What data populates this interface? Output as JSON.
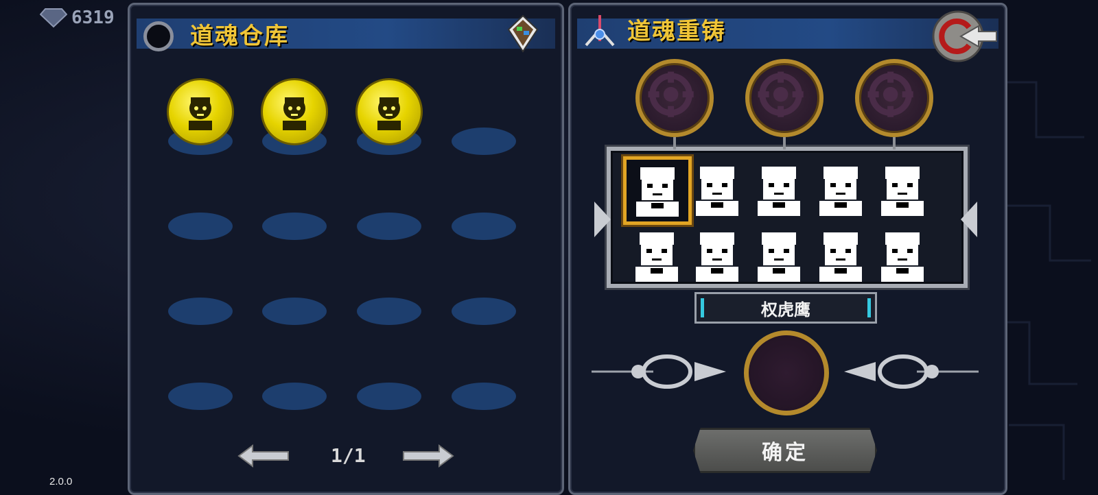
{
  "hud": {
    "gem_count": "6319",
    "version": "2.0.0"
  },
  "left_panel": {
    "title": "道魂仓库",
    "slots_rows": 4,
    "slots_cols": 4,
    "souls": [
      {
        "icon": "gold-soul-girl-icon"
      },
      {
        "icon": "gold-soul-mask-icon"
      },
      {
        "icon": "gold-soul-bun-icon"
      }
    ],
    "pager": {
      "label": "1/1"
    }
  },
  "right_panel": {
    "title": "道魂重铸",
    "selected_name": "权虎鹰",
    "confirm_label": "确定",
    "portraits": [
      {
        "icon": "portrait-bangs-icon"
      },
      {
        "icon": "portrait-glasses-icon"
      },
      {
        "icon": "portrait-bandana-icon"
      },
      {
        "icon": "portrait-longhair-icon"
      },
      {
        "icon": "portrait-masked-icon"
      },
      {
        "icon": "portrait-tusk-icon"
      },
      {
        "icon": "portrait-flower-icon"
      },
      {
        "icon": "portrait-cowboy-icon"
      },
      {
        "icon": "portrait-viking-icon"
      },
      {
        "icon": "portrait-bunny-icon"
      }
    ]
  },
  "colors": {
    "title_gold": "#f0c537",
    "header_blue": "#234a85",
    "slot_blue": "#1d3e6e",
    "soul_gold": "#e6d400",
    "orb_frame": "#b48a2c",
    "select_frame": "#e2a524",
    "accent_cyan": "#35c9e0"
  }
}
